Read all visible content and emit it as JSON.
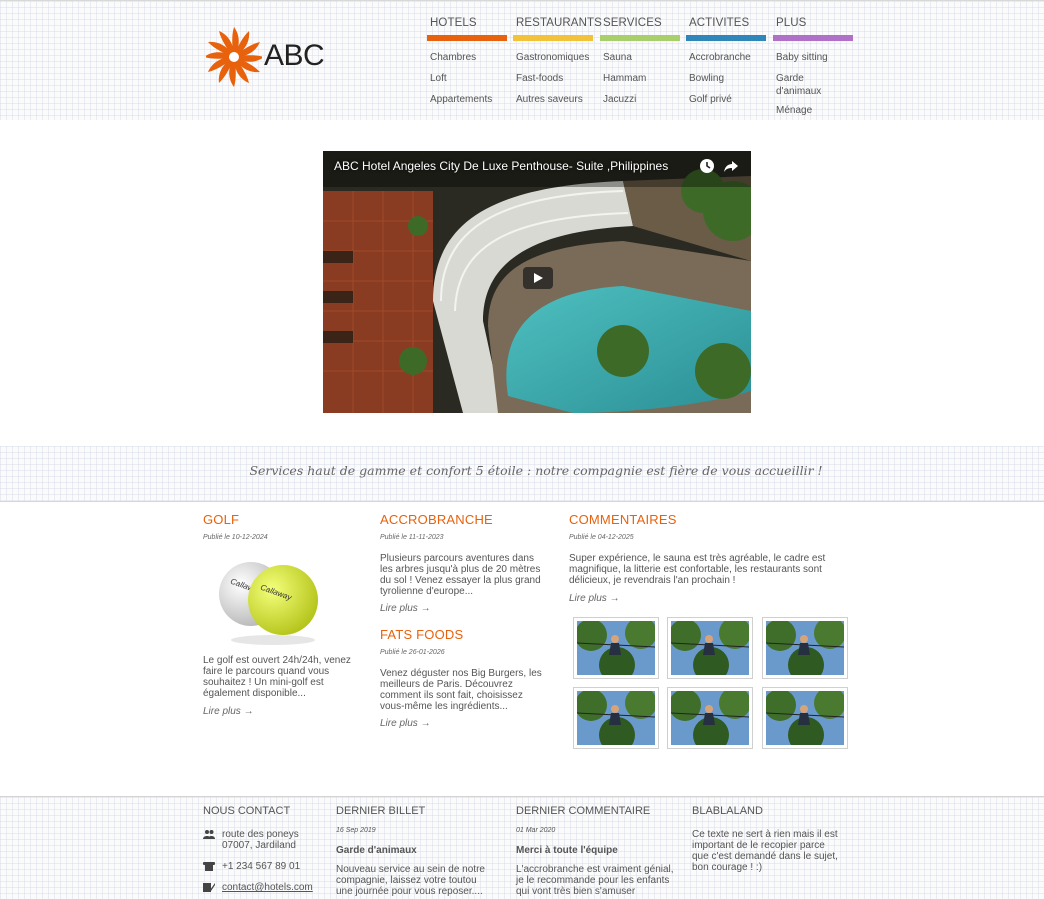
{
  "brand": {
    "logo_text": "ABC",
    "accent": "#e8610c"
  },
  "menu": [
    {
      "title": "HOTELS",
      "color": "#e8610c",
      "items": [
        "Chambres",
        "Loft",
        "Appartements"
      ]
    },
    {
      "title": "RESTAURANTS",
      "color": "#f2c23a",
      "items": [
        "Gastronomiques",
        "Fast-foods",
        "Autres saveurs"
      ]
    },
    {
      "title": "SERVICES",
      "color": "#a9cf6d",
      "items": [
        "Sauna",
        "Hammam",
        "Jacuzzi"
      ]
    },
    {
      "title": "ACTIVITES",
      "color": "#2e87b8",
      "items": [
        "Accrobranche",
        "Bowling",
        "Golf privé"
      ]
    },
    {
      "title": "PLUS",
      "color": "#b070c8",
      "items": [
        "Baby sitting",
        "Garde d'animaux",
        "Ménage"
      ]
    }
  ],
  "video": {
    "title": "ABC Hotel Angeles City De Luxe Penthouse- Suite ,Philippines",
    "icons": [
      "clock-icon",
      "share-icon",
      "play-icon"
    ]
  },
  "tagline": "Services haut de gamme et confort 5 étoile : notre compagnie est fière de vous accueillir !",
  "golf": {
    "title": "GOLF",
    "date": "Publié le 10-12-2024",
    "text": "Le golf est ouvert 24h/24h, venez faire le parcours quand vous souhaitez ! Un mini-golf est également disponible...",
    "more": "Lire plus →"
  },
  "accrobranche": {
    "title": "ACCROBRANCHE",
    "date": "Publié le 11-11-2023",
    "text": "Plusieurs parcours aventures dans les arbres jusqu'à plus de 20 mètres du sol ! Venez essayer la plus grand tyrolienne d'europe...",
    "more": "Lire plus →"
  },
  "fastfoods": {
    "title": "FATS FOODS",
    "date": "Publié le 26-01-2026",
    "text": "Venez déguster nos Big Burgers, les meilleurs de Paris. Découvrez comment ils sont fait, choisissez vous-même les ingrédients...",
    "more": "Lire plus →"
  },
  "comments": {
    "title": "COMMENTAIRES",
    "date": "Publié le 04-12-2025",
    "text": "Super expérience, le sauna est très agréable, le cadre est magnifique, la litterie est confortable, les restaurants sont délicieux, je revendrais l'an prochain !",
    "more": "Lire plus →"
  },
  "footer": {
    "contact": {
      "title": "NOUS CONTACT",
      "address": "route des poneys 07007, Jardiland",
      "phone": "+1 234 567 89 01",
      "email": "contact@hotels.com"
    },
    "billet": {
      "title": "DERNIER BILLET",
      "date": "16 Sep 2019",
      "head": "Garde d'animaux",
      "text": "Nouveau service au sein de notre compagnie, laissez votre toutou une journée pour vous reposer...."
    },
    "commentaire": {
      "title": "DERNIER COMMENTAIRE",
      "date": "01 Mar 2020",
      "head": "Merci à toute l'équipe",
      "text": "L'accrobranche est vraiment génial, je le recommande pour les enfants qui vont très bien s'amuser"
    },
    "blabla": {
      "title": "BLABLALAND",
      "text": "Ce texte ne sert à rien mais il est important de le recopier parce que c'est demandé dans le sujet, bon courage ! :)"
    }
  }
}
